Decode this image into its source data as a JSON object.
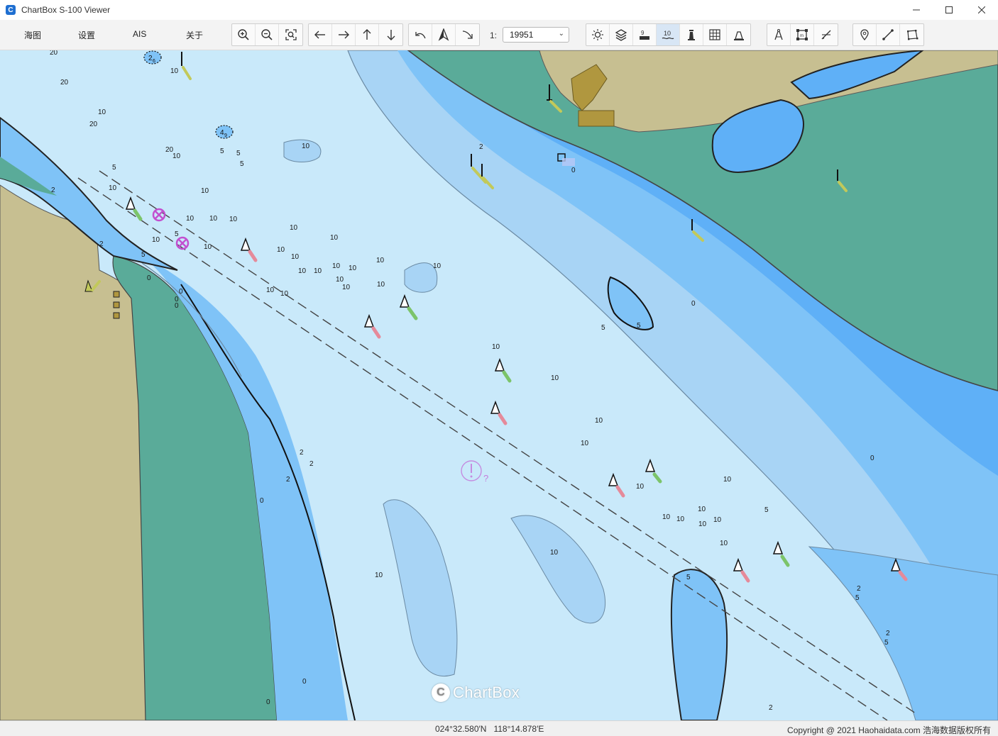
{
  "window": {
    "title": "ChartBox S-100 Viewer",
    "icon_letter": "C",
    "controls": [
      "minimize-icon",
      "maximize-icon",
      "close-icon"
    ]
  },
  "menu": {
    "items": [
      {
        "label": "海图"
      },
      {
        "label": "设置"
      },
      {
        "label": "AIS"
      },
      {
        "label": "关于"
      }
    ]
  },
  "toolbar": {
    "zoom_group": [
      "zoom-in-icon",
      "zoom-out-icon",
      "zoom-fit-icon"
    ],
    "pan_group": [
      "arrow-left-icon",
      "arrow-right-icon",
      "arrow-up-icon",
      "arrow-down-icon"
    ],
    "orientation_group": [
      "rotate-left-icon",
      "north-up-icon",
      "rotate-right-icon"
    ],
    "scale_label": "1:",
    "scale_value": "19951",
    "display_group": [
      "brightness-icon",
      "layers-icon",
      "depth-icon",
      "soundings-icon",
      "lighthouse-icon",
      "grid-icon",
      "anchor-area-icon"
    ],
    "active_display": "soundings-icon",
    "measure_group": [
      "compass-icon",
      "frame-icon",
      "distance-icon"
    ],
    "draw_group": [
      "pin-icon",
      "line-icon",
      "polygon-icon"
    ]
  },
  "map": {
    "colors": {
      "deep_water": "#c9e9fa",
      "medium_water": "#a8d4f5",
      "shallow_water": "#7fc3f7",
      "very_shallow": "#5fb0f7",
      "intertidal": "#5aab99",
      "land": "#c7bf91",
      "buoy_green": "#7cc46a",
      "buoy_red": "#e58a9a",
      "wreck_magenta": "#c24fcf"
    },
    "soundings": [
      "20",
      "20",
      "10",
      "10",
      "20",
      "20",
      "10",
      "10",
      "10",
      "10",
      "10",
      "10",
      "10",
      "10",
      "10",
      "10",
      "10",
      "10",
      "10",
      "10",
      "10",
      "10",
      "10",
      "10",
      "10",
      "10",
      "10",
      "10",
      "10",
      "10",
      "10",
      "10",
      "10",
      "10",
      "10",
      "10",
      "10",
      "10",
      "10",
      "10",
      "10",
      "10",
      "10",
      "10",
      "5",
      "5",
      "5",
      "5",
      "5",
      "5",
      "5",
      "5",
      "5",
      "5",
      "5",
      "5",
      "2",
      "2",
      "2",
      "2",
      "2",
      "2",
      "2",
      "2",
      "2",
      "0",
      "0",
      "0",
      "0",
      "0",
      "0",
      "0",
      "0",
      "0",
      "0"
    ],
    "labels": {
      "spot_4": "4",
      "spot_4_sub": "9",
      "spot_2": "2",
      "spot_2_sub": "6",
      "danger_q": "?"
    },
    "watermark": "ChartBox",
    "watermark_icon": "C"
  },
  "status": {
    "latitude": "024°32.580′N",
    "longitude": "118°14.878′E",
    "copyright": "Copyright @ 2021 Haohaidata.com 浩海数据版权所有"
  }
}
